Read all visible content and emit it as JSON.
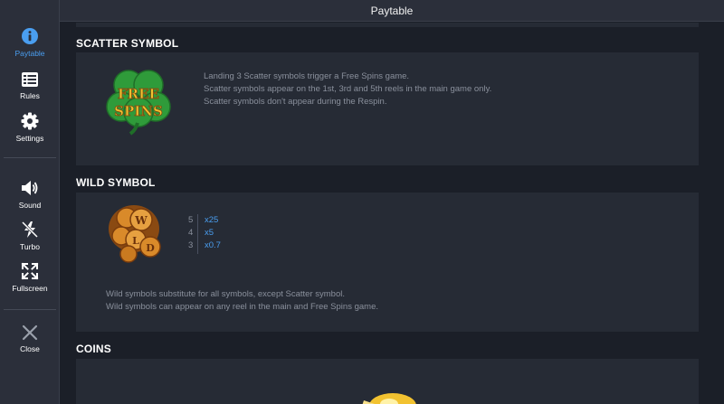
{
  "header": {
    "title": "Paytable"
  },
  "sidebar": {
    "items": [
      {
        "label": "Paytable",
        "icon": "info-icon",
        "active": true
      },
      {
        "label": "Rules",
        "icon": "list-icon"
      },
      {
        "label": "Settings",
        "icon": "gear-icon"
      },
      {
        "label": "Sound",
        "icon": "speaker-icon"
      },
      {
        "label": "Turbo",
        "icon": "lightning-off-icon"
      },
      {
        "label": "Fullscreen",
        "icon": "fullscreen-icon"
      },
      {
        "label": "Close",
        "icon": "close-icon"
      }
    ]
  },
  "sections": {
    "scatter": {
      "title": "SCATTER SYMBOL",
      "symbol_text": "FREE SPINS",
      "symbol_line1": "FREE",
      "symbol_line2": "SPINS",
      "lines": [
        "Landing 3 Scatter symbols trigger a Free Spins game.",
        "Scatter symbols appear on the 1st, 3rd and 5th reels in the main game only.",
        "Scatter symbols don't appear during the Respin."
      ]
    },
    "wild": {
      "title": "WILD SYMBOL",
      "payouts": [
        {
          "count": "5",
          "multiplier": "x25"
        },
        {
          "count": "4",
          "multiplier": "x5"
        },
        {
          "count": "3",
          "multiplier": "x0.7"
        }
      ],
      "lines": [
        "Wild symbols substitute for all symbols, except Scatter symbol.",
        "Wild symbols can appear on any reel in the main and Free Spins game."
      ]
    },
    "coins": {
      "title": "COINS"
    }
  },
  "colors": {
    "accent": "#4a9ef0",
    "background": "#1b1f28",
    "panel": "#262b35",
    "sidebar": "#2b2f3a",
    "clover": "#2f9b3a",
    "gold": "#e0a020"
  }
}
